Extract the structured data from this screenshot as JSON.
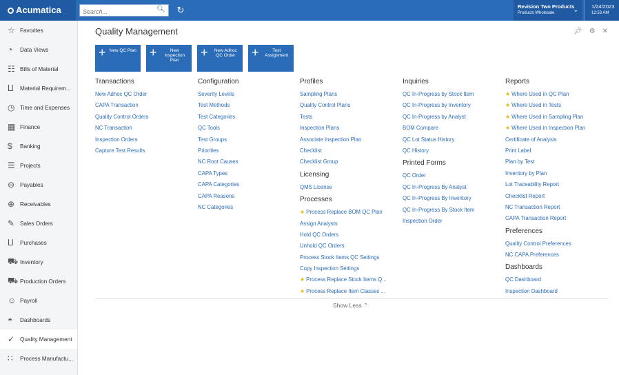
{
  "header": {
    "brand": "Acumatica",
    "search_placeholder": "Search...",
    "tenant_name": "Revision Two Products",
    "tenant_branch": "Products Wholesale",
    "date": "1/24/2023",
    "time": "12:53 AM"
  },
  "sidebar": {
    "items": [
      {
        "label": "Favorites",
        "icon": "star-icon"
      },
      {
        "label": "Data Views",
        "icon": "pie-chart-icon"
      },
      {
        "label": "Bills of Material",
        "icon": "document-icon"
      },
      {
        "label": "Material Requirem...",
        "icon": "cart-icon"
      },
      {
        "label": "Time and Expenses",
        "icon": "clock-icon"
      },
      {
        "label": "Finance",
        "icon": "calculator-icon"
      },
      {
        "label": "Banking",
        "icon": "dollar-icon"
      },
      {
        "label": "Projects",
        "icon": "projects-icon"
      },
      {
        "label": "Payables",
        "icon": "minus-circle-icon"
      },
      {
        "label": "Receivables",
        "icon": "plus-circle-icon"
      },
      {
        "label": "Sales Orders",
        "icon": "edit-icon"
      },
      {
        "label": "Purchases",
        "icon": "cart-icon"
      },
      {
        "label": "Inventory",
        "icon": "truck-icon"
      },
      {
        "label": "Production Orders",
        "icon": "truck-icon"
      },
      {
        "label": "Payroll",
        "icon": "people-icon"
      },
      {
        "label": "Dashboards",
        "icon": "gauge-icon"
      },
      {
        "label": "Quality Management",
        "icon": "check-circle-icon"
      },
      {
        "label": "Process Manufactu...",
        "icon": "grid-icon"
      }
    ],
    "active_index": 16
  },
  "page": {
    "title": "Quality Management",
    "quick_buttons": [
      {
        "label": "New QC Plan"
      },
      {
        "label": "New Inspection Plan"
      },
      {
        "label": "New Adhoc QC Order"
      },
      {
        "label": "Test Assignment"
      }
    ],
    "show_less": "Show Less"
  },
  "columns": {
    "c1": {
      "sections": [
        {
          "title": "Transactions",
          "links": [
            {
              "text": "New Adhoc QC Order",
              "star": false
            },
            {
              "text": "CAPA Transaction",
              "star": false
            },
            {
              "text": "Quality Control Orders",
              "star": false
            },
            {
              "text": "NC Transaction",
              "star": false
            },
            {
              "text": "Inspection Orders",
              "star": false
            },
            {
              "text": "Capture Test Results",
              "star": false
            }
          ]
        }
      ]
    },
    "c2": {
      "sections": [
        {
          "title": "Configuration",
          "links": [
            {
              "text": "Severity Levels",
              "star": false
            },
            {
              "text": "Test Methods",
              "star": false
            },
            {
              "text": "Test Categories",
              "star": false
            },
            {
              "text": "QC Tools",
              "star": false
            },
            {
              "text": "Test Groups",
              "star": false
            },
            {
              "text": "Priorities",
              "star": false
            },
            {
              "text": "NC Root Causes",
              "star": false
            },
            {
              "text": "CAPA Types",
              "star": false
            },
            {
              "text": "CAPA Categories",
              "star": false
            },
            {
              "text": "CAPA Reasons",
              "star": false
            },
            {
              "text": "NC Categories",
              "star": false
            }
          ]
        }
      ]
    },
    "c3": {
      "sections": [
        {
          "title": "Profiles",
          "links": [
            {
              "text": "Sampling Plans",
              "star": false
            },
            {
              "text": "Quality Control Plans",
              "star": false
            },
            {
              "text": "Tests",
              "star": false
            },
            {
              "text": "Inspection Plans",
              "star": false
            },
            {
              "text": "Associate Inspection Plan",
              "star": false
            },
            {
              "text": "Checklist",
              "star": false
            },
            {
              "text": "Checklist Group",
              "star": false
            }
          ]
        },
        {
          "title": "Licensing",
          "links": [
            {
              "text": "QMS License",
              "star": false
            }
          ]
        },
        {
          "title": "Processes",
          "links": [
            {
              "text": "Process Replace BOM QC Plan",
              "star": true
            },
            {
              "text": "Assign Analysts",
              "star": false
            },
            {
              "text": "Hold QC Orders",
              "star": false
            },
            {
              "text": "Unhold QC Orders",
              "star": false
            },
            {
              "text": "Process Stock Items QC Settings",
              "star": false
            },
            {
              "text": "Copy Inspection Settings",
              "star": false
            },
            {
              "text": "Process Replace Stock Items Q...",
              "star": true
            },
            {
              "text": "Process Replace Item Classes ...",
              "star": true
            }
          ]
        }
      ]
    },
    "c4": {
      "sections": [
        {
          "title": "Inquiries",
          "links": [
            {
              "text": "QC In-Progress by Stock Item",
              "star": false
            },
            {
              "text": "QC In-Progress by Inventory",
              "star": false
            },
            {
              "text": "QC In-Progress by Analyst",
              "star": false
            },
            {
              "text": "BOM Compare",
              "star": false
            },
            {
              "text": "QC Lot Status History",
              "star": false
            },
            {
              "text": "QC History",
              "star": false
            }
          ]
        },
        {
          "title": "Printed Forms",
          "links": [
            {
              "text": "QC Order",
              "star": false
            },
            {
              "text": "QC In-Progress By Analyst",
              "star": false
            },
            {
              "text": "QC In-Progress By Inventory",
              "star": false
            },
            {
              "text": "QC In-Progress By Stock Item",
              "star": false
            },
            {
              "text": "Inspection Order",
              "star": false
            }
          ]
        }
      ]
    },
    "c5": {
      "sections": [
        {
          "title": "Reports",
          "links": [
            {
              "text": "Where Used in QC Plan",
              "star": true
            },
            {
              "text": "Where Used in Tests",
              "star": true
            },
            {
              "text": "Where Used in Sampling Plan",
              "star": true
            },
            {
              "text": "Where Used in Inspection Plan",
              "star": true
            },
            {
              "text": "Certificate of Analysis",
              "star": false
            },
            {
              "text": "Print Label",
              "star": false
            },
            {
              "text": "Plan by Test",
              "star": false
            },
            {
              "text": "Inventory by Plan",
              "star": false
            },
            {
              "text": "Lot Traceability Report",
              "star": false
            },
            {
              "text": "Checklist Report",
              "star": false
            },
            {
              "text": "NC Transaction Report",
              "star": false
            },
            {
              "text": "CAPA Transaction Report",
              "star": false
            }
          ]
        },
        {
          "title": "Preferences",
          "links": [
            {
              "text": "Quality Control Preferences",
              "star": false
            },
            {
              "text": "NC CAPA Preferences",
              "star": false
            }
          ]
        },
        {
          "title": "Dashboards",
          "links": [
            {
              "text": "QC Dashboard",
              "star": false
            },
            {
              "text": "Inspection Dashboard",
              "star": false
            }
          ]
        }
      ]
    }
  }
}
